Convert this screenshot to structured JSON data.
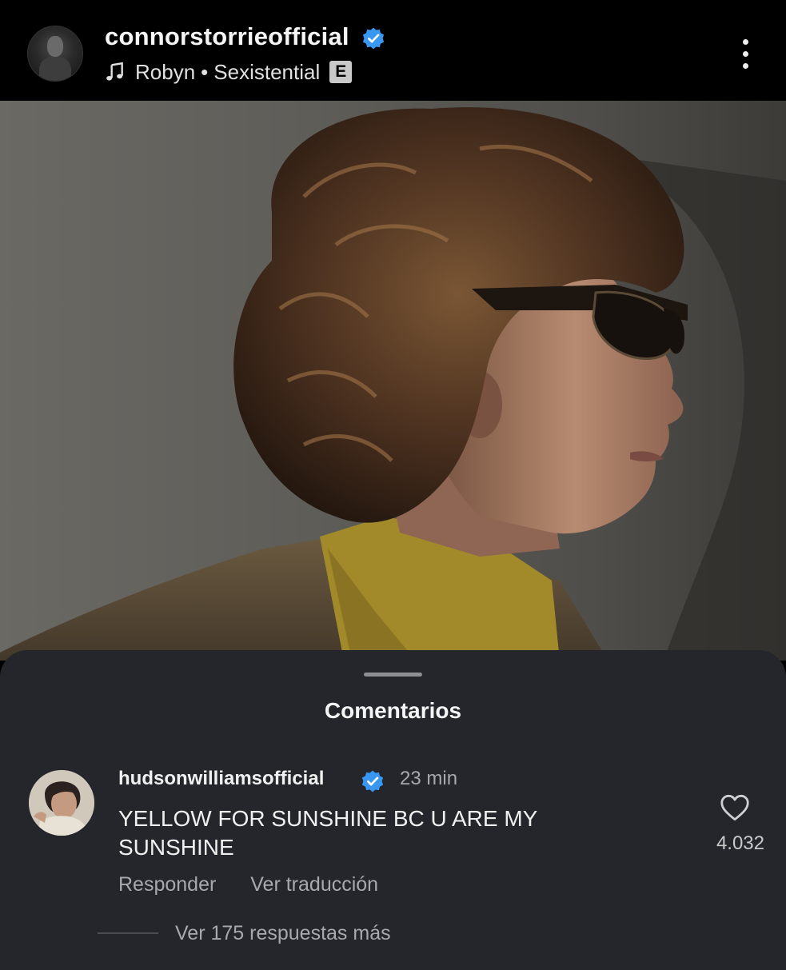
{
  "post": {
    "username": "connorstorrieofficial",
    "music": {
      "artist": "Robyn",
      "separator": "•",
      "song": "Sexistential",
      "explicit_badge": "E"
    }
  },
  "comments_sheet": {
    "title": "Comentarios",
    "comment": {
      "username": "hudsonwilliamsofficial",
      "time": "23 min",
      "text": "YELLOW FOR SUNSHINE BC U ARE MY SUNSHINE",
      "like_count": "4.032",
      "reply_label": "Responder",
      "translate_label": "Ver traducción",
      "more_replies_label": "Ver 175 respuestas más"
    }
  },
  "colors": {
    "verified": "#3897f0",
    "sheet_bg": "#24262c",
    "header_bg": "#000000"
  },
  "icons": [
    "verified-badge-icon",
    "music-note-icon",
    "more-options-icon",
    "heart-icon"
  ]
}
